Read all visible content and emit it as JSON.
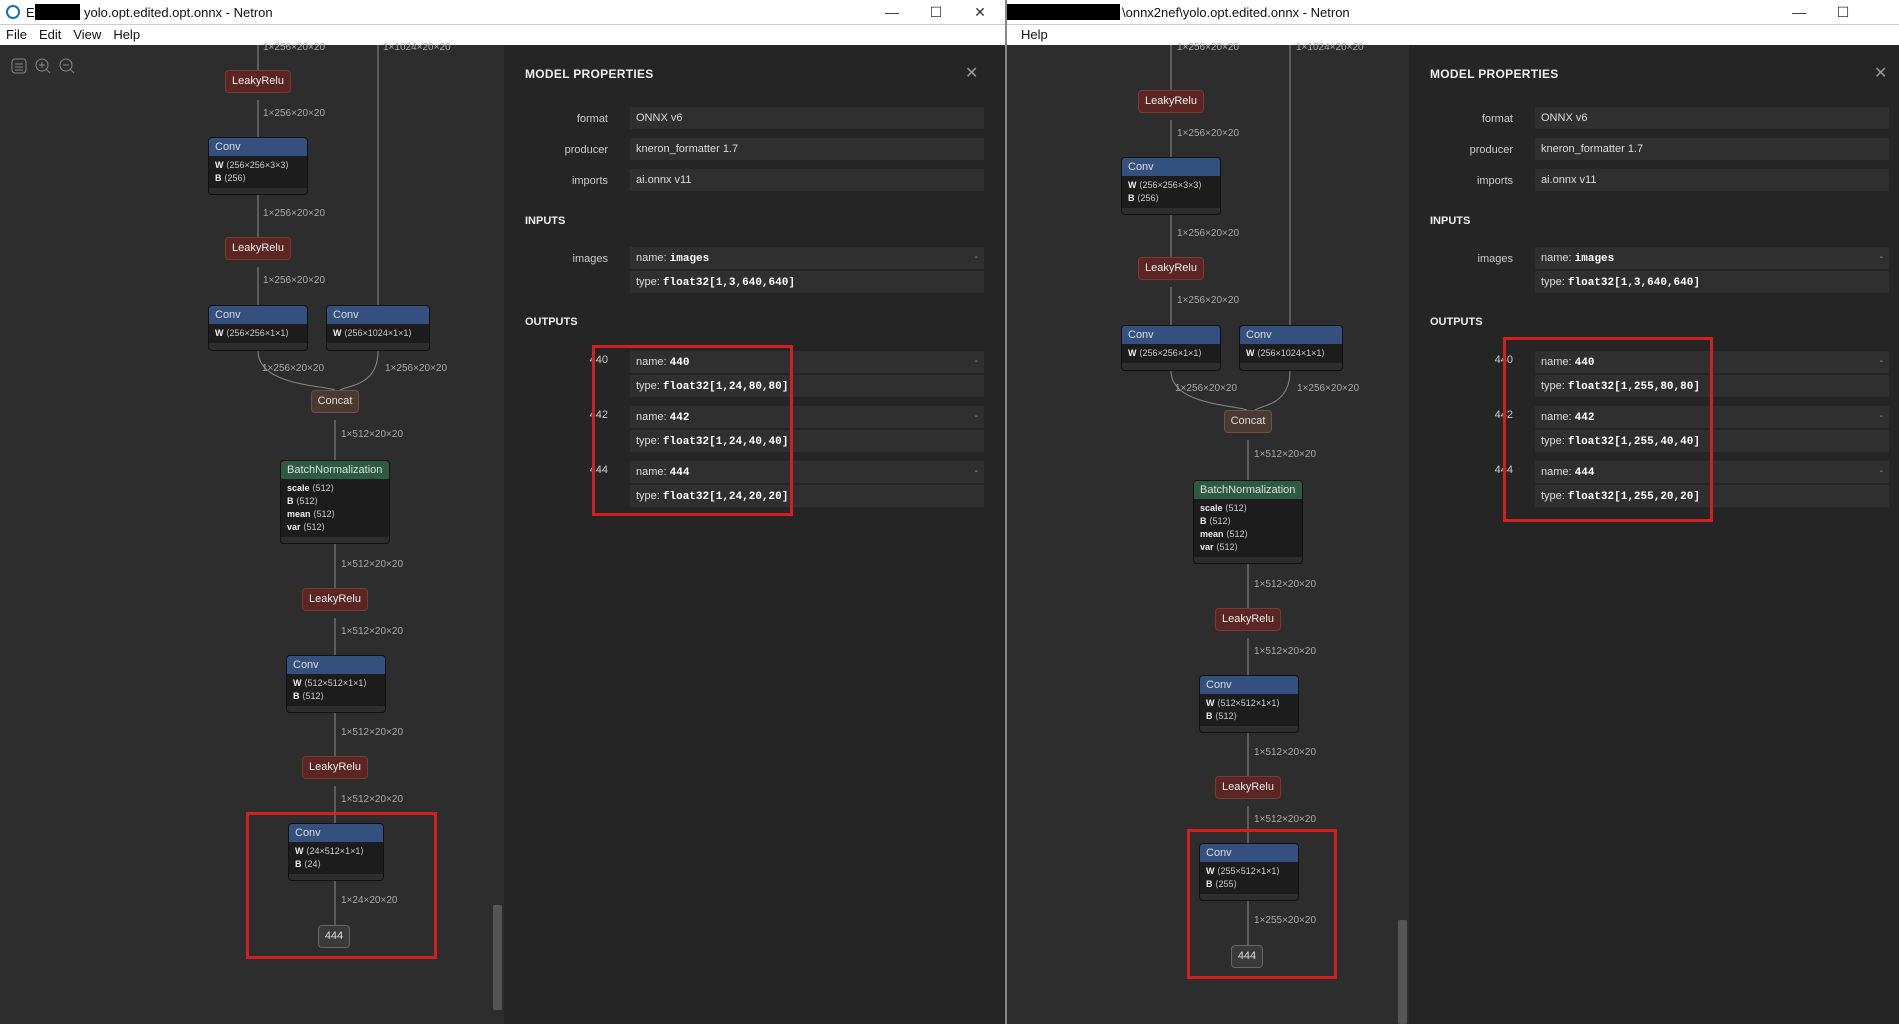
{
  "left": {
    "title": "yolo.opt.edited.opt.onnx - Netron",
    "title_prefix": "E",
    "menu": [
      "File",
      "Edit",
      "View",
      "Help"
    ],
    "graph": {
      "edge_top_left": "1×256×20×20",
      "edge_top_right": "1×1024×20×20",
      "lrelu1": "LeakyRelu",
      "edge2": "1×256×20×20",
      "conv1": {
        "title": "Conv",
        "w": "⟨256×256×3×3⟩",
        "b": "⟨256⟩"
      },
      "edge3": "1×256×20×20",
      "lrelu2": "LeakyRelu",
      "edge4": "1×256×20×20",
      "conv2": {
        "title": "Conv",
        "w": "⟨256×256×1×1⟩"
      },
      "conv3": {
        "title": "Conv",
        "w": "⟨256×1024×1×1⟩"
      },
      "edge5a": "1×256×20×20",
      "edge5b": "1×256×20×20",
      "concat": "Concat",
      "edge6": "1×512×20×20",
      "bn": {
        "title": "BatchNormalization",
        "scale": "⟨512⟩",
        "b": "⟨512⟩",
        "mean": "⟨512⟩",
        "var": "⟨512⟩"
      },
      "edge7": "1×512×20×20",
      "lrelu3": "LeakyRelu",
      "edge8": "1×512×20×20",
      "conv4": {
        "title": "Conv",
        "w": "⟨512×512×1×1⟩",
        "b": "⟨512⟩"
      },
      "edge9": "1×512×20×20",
      "lrelu4": "LeakyRelu",
      "edge10": "1×512×20×20",
      "conv5": {
        "title": "Conv",
        "w": "⟨24×512×1×1⟩",
        "b": "⟨24⟩"
      },
      "edge11": "1×24×20×20",
      "out": "444"
    },
    "props": {
      "title": "MODEL PROPERTIES",
      "format_label": "format",
      "format": "ONNX v6",
      "producer_label": "producer",
      "producer": "kneron_formatter 1.7",
      "imports_label": "imports",
      "imports": "ai.onnx v11",
      "inputs": "INPUTS",
      "in_name_label": "images",
      "in_name": "images",
      "in_type": "float32[1,3,640,640]",
      "outputs": "OUTPUTS",
      "o1_label": "440",
      "o1_name": "440",
      "o1_type": "float32[1,24,80,80]",
      "o2_label": "442",
      "o2_name": "442",
      "o2_type": "float32[1,24,40,40]",
      "o3_label": "444",
      "o3_name": "444",
      "o3_type": "float32[1,24,20,20]"
    }
  },
  "right": {
    "title": "\\onnx2nef\\yolo.opt.edited.onnx - Netron",
    "menu": [
      "Help"
    ],
    "graph": {
      "edge_top_left": "1×256×20×20",
      "edge_top_right": "1×1024×20×20",
      "lrelu1": "LeakyRelu",
      "edge2": "1×256×20×20",
      "conv1": {
        "title": "Conv",
        "w": "⟨256×256×3×3⟩",
        "b": "⟨256⟩"
      },
      "edge3": "1×256×20×20",
      "lrelu2": "LeakyRelu",
      "edge4": "1×256×20×20",
      "conv2": {
        "title": "Conv",
        "w": "⟨256×256×1×1⟩"
      },
      "conv3": {
        "title": "Conv",
        "w": "⟨256×1024×1×1⟩"
      },
      "edge5a": "1×256×20×20",
      "edge5b": "1×256×20×20",
      "concat": "Concat",
      "edge6": "1×512×20×20",
      "bn": {
        "title": "BatchNormalization",
        "scale": "⟨512⟩",
        "b": "⟨512⟩",
        "mean": "⟨512⟩",
        "var": "⟨512⟩"
      },
      "edge7": "1×512×20×20",
      "lrelu3": "LeakyRelu",
      "edge8": "1×512×20×20",
      "conv4": {
        "title": "Conv",
        "w": "⟨512×512×1×1⟩",
        "b": "⟨512⟩"
      },
      "edge9": "1×512×20×20",
      "lrelu4": "LeakyRelu",
      "edge10": "1×512×20×20",
      "conv5": {
        "title": "Conv",
        "w": "⟨255×512×1×1⟩",
        "b": "⟨255⟩"
      },
      "edge11": "1×255×20×20",
      "out": "444"
    },
    "props": {
      "title": "MODEL PROPERTIES",
      "format_label": "format",
      "format": "ONNX v6",
      "producer_label": "producer",
      "producer": "kneron_formatter 1.7",
      "imports_label": "imports",
      "imports": "ai.onnx v11",
      "inputs": "INPUTS",
      "in_name_label": "images",
      "in_name": "images",
      "in_type": "float32[1,3,640,640]",
      "outputs": "OUTPUTS",
      "o1_label": "440",
      "o1_name": "440",
      "o1_type": "float32[1,255,80,80]",
      "o2_label": "442",
      "o2_name": "442",
      "o2_type": "float32[1,255,40,40]",
      "o3_label": "444",
      "o3_name": "444",
      "o3_type": "float32[1,255,20,20]"
    }
  },
  "common": {
    "name_prefix": "name: ",
    "type_prefix": "type: ",
    "w_key": "W",
    "b_key": "B",
    "scale_key": "scale",
    "mean_key": "mean",
    "var_key": "var",
    "dash": "-",
    "close": "✕",
    "minimize": "—",
    "maximize": "☐",
    "win_close": "✕"
  }
}
